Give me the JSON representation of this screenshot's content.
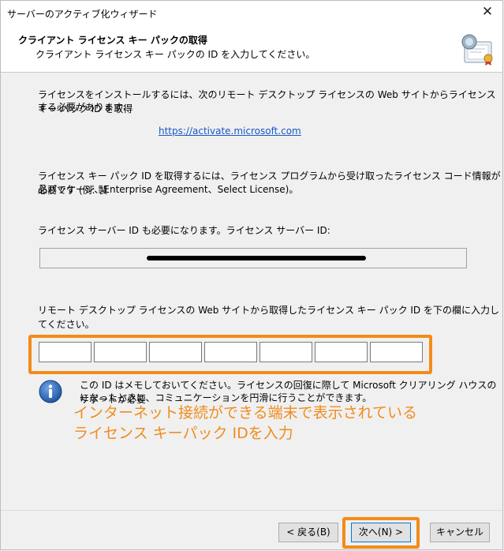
{
  "window": {
    "title": "サーバーのアクティブ化ウィザード",
    "close_glyph": "✕"
  },
  "header": {
    "title": "クライアント ライセンス キー パックの取得",
    "subtitle": "クライアント ライセンス キー パックの ID を入力してください。",
    "icon": "license-certificate-icon"
  },
  "content": {
    "intro_line1": "ライセンスをインストールするには、次のリモート デスクトップ ライセンスの Web サイトからライセンス キー パック ID を取得",
    "intro_line2": "する必要があります:",
    "url": "https://activate.microsoft.com",
    "need_line1": "ライセンス キー パック ID を取得するには、ライセンス プログラムから受け取ったライセンス コード情報が必要です (例: 製",
    "need_line2": "品パッケージ、Enterprise Agreement、Select License)。",
    "server_id_label": "ライセンス サーバー ID も必要になります。ライセンス サーバー ID:",
    "enter_instruction": "リモート デスクトップ ライセンスの Web サイトから取得したライセンス キー パック ID を下の欄に入力してください。",
    "id_fields": [
      "",
      "",
      "",
      "",
      "",
      "",
      ""
    ],
    "info_line1": "この ID はメモしておいてください。ライセンスの回復に際して Microsoft クリアリング ハウスのサポートが必要",
    "info_line2": "になったときに、コミュニケーションを円滑に行うことができます。",
    "info_icon": "info-icon"
  },
  "annotation": {
    "line1": "インターネット接続ができる端末で表示されている",
    "line2": "ライセンス キーパック IDを入力",
    "color": "#f08c1c"
  },
  "buttons": {
    "back": "< 戻る(B)",
    "next": "次へ(N) >",
    "cancel": "キャンセル"
  },
  "colors": {
    "highlight": "#f28c1a",
    "link": "#1a56c8"
  }
}
